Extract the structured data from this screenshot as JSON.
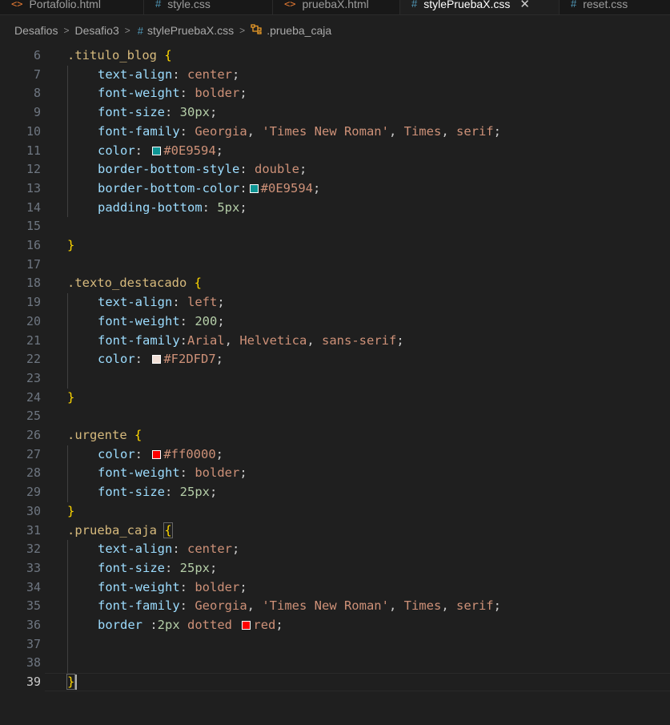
{
  "tabs": [
    {
      "label": "Portafolio.html",
      "icon": "html-icon",
      "active": false
    },
    {
      "label": "style.css",
      "icon": "css-icon",
      "active": false
    },
    {
      "label": "pruebaX.html",
      "icon": "html-icon",
      "active": false
    },
    {
      "label": "stylePruebaX.css",
      "icon": "css-icon",
      "active": true
    },
    {
      "label": "reset.css",
      "icon": "css-icon",
      "active": false
    }
  ],
  "breadcrumb": {
    "folder1": "Desafios",
    "folder2": "Desafio3",
    "file": "stylePruebaX.css",
    "symbol": ".prueba_caja"
  },
  "editor": {
    "current_line": "39",
    "lines": [
      {
        "n": "6",
        "tokens": [
          {
            "t": "sel",
            "v": ".titulo_blog"
          },
          {
            "t": "punct",
            "v": " "
          },
          {
            "t": "brace",
            "v": "{"
          }
        ]
      },
      {
        "n": "7",
        "indent": true,
        "tokens": [
          {
            "t": "prop",
            "v": "text-align"
          },
          {
            "t": "punct",
            "v": ": "
          },
          {
            "t": "val",
            "v": "center"
          },
          {
            "t": "punct",
            "v": ";"
          }
        ]
      },
      {
        "n": "8",
        "indent": true,
        "tokens": [
          {
            "t": "prop",
            "v": "font-weight"
          },
          {
            "t": "punct",
            "v": ": "
          },
          {
            "t": "val",
            "v": "bolder"
          },
          {
            "t": "punct",
            "v": ";"
          }
        ]
      },
      {
        "n": "9",
        "indent": true,
        "tokens": [
          {
            "t": "prop",
            "v": "font-size"
          },
          {
            "t": "punct",
            "v": ": "
          },
          {
            "t": "num",
            "v": "30px"
          },
          {
            "t": "punct",
            "v": ";"
          }
        ]
      },
      {
        "n": "10",
        "indent": true,
        "tokens": [
          {
            "t": "prop",
            "v": "font-family"
          },
          {
            "t": "punct",
            "v": ": "
          },
          {
            "t": "val",
            "v": "Georgia"
          },
          {
            "t": "punct",
            "v": ", "
          },
          {
            "t": "val",
            "v": "'Times New Roman'"
          },
          {
            "t": "punct",
            "v": ", "
          },
          {
            "t": "val",
            "v": "Times"
          },
          {
            "t": "punct",
            "v": ", "
          },
          {
            "t": "val",
            "v": "serif"
          },
          {
            "t": "punct",
            "v": ";"
          }
        ]
      },
      {
        "n": "11",
        "indent": true,
        "tokens": [
          {
            "t": "prop",
            "v": "color"
          },
          {
            "t": "punct",
            "v": ": "
          },
          {
            "t": "swatch",
            "c": "#0E9594"
          },
          {
            "t": "val",
            "v": "#0E9594"
          },
          {
            "t": "punct",
            "v": ";"
          }
        ]
      },
      {
        "n": "12",
        "indent": true,
        "tokens": [
          {
            "t": "prop",
            "v": "border-bottom-style"
          },
          {
            "t": "punct",
            "v": ": "
          },
          {
            "t": "val",
            "v": "double"
          },
          {
            "t": "punct",
            "v": ";"
          }
        ]
      },
      {
        "n": "13",
        "indent": true,
        "tokens": [
          {
            "t": "prop",
            "v": "border-bottom-color"
          },
          {
            "t": "punct",
            "v": ":"
          },
          {
            "t": "swatch",
            "c": "#0E9594"
          },
          {
            "t": "val",
            "v": "#0E9594"
          },
          {
            "t": "punct",
            "v": ";"
          }
        ]
      },
      {
        "n": "14",
        "indent": true,
        "tokens": [
          {
            "t": "prop",
            "v": "padding-bottom"
          },
          {
            "t": "punct",
            "v": ": "
          },
          {
            "t": "num",
            "v": "5px"
          },
          {
            "t": "punct",
            "v": ";"
          }
        ]
      },
      {
        "n": "15",
        "tokens": []
      },
      {
        "n": "16",
        "tokens": [
          {
            "t": "brace",
            "v": "}"
          }
        ]
      },
      {
        "n": "17",
        "tokens": []
      },
      {
        "n": "18",
        "tokens": [
          {
            "t": "sel",
            "v": ".texto_destacado"
          },
          {
            "t": "punct",
            "v": " "
          },
          {
            "t": "brace",
            "v": "{"
          }
        ]
      },
      {
        "n": "19",
        "indent": true,
        "tokens": [
          {
            "t": "prop",
            "v": "text-align"
          },
          {
            "t": "punct",
            "v": ": "
          },
          {
            "t": "val",
            "v": "left"
          },
          {
            "t": "punct",
            "v": ";"
          }
        ]
      },
      {
        "n": "20",
        "indent": true,
        "tokens": [
          {
            "t": "prop",
            "v": "font-weight"
          },
          {
            "t": "punct",
            "v": ": "
          },
          {
            "t": "num",
            "v": "200"
          },
          {
            "t": "punct",
            "v": ";"
          }
        ]
      },
      {
        "n": "21",
        "indent": true,
        "tokens": [
          {
            "t": "prop",
            "v": "font-family"
          },
          {
            "t": "punct",
            "v": ":"
          },
          {
            "t": "val",
            "v": "Arial"
          },
          {
            "t": "punct",
            "v": ", "
          },
          {
            "t": "val",
            "v": "Helvetica"
          },
          {
            "t": "punct",
            "v": ", "
          },
          {
            "t": "val",
            "v": "sans-serif"
          },
          {
            "t": "punct",
            "v": ";"
          }
        ]
      },
      {
        "n": "22",
        "indent": true,
        "tokens": [
          {
            "t": "prop",
            "v": "color"
          },
          {
            "t": "punct",
            "v": ": "
          },
          {
            "t": "swatch",
            "c": "#F2DFD7"
          },
          {
            "t": "val",
            "v": "#F2DFD7"
          },
          {
            "t": "punct",
            "v": ";"
          }
        ]
      },
      {
        "n": "23",
        "tokens": []
      },
      {
        "n": "24",
        "tokens": [
          {
            "t": "brace",
            "v": "}"
          }
        ]
      },
      {
        "n": "25",
        "tokens": []
      },
      {
        "n": "26",
        "tokens": [
          {
            "t": "sel",
            "v": ".urgente"
          },
          {
            "t": "punct",
            "v": " "
          },
          {
            "t": "brace",
            "v": "{"
          }
        ]
      },
      {
        "n": "27",
        "indent": true,
        "tokens": [
          {
            "t": "prop",
            "v": "color"
          },
          {
            "t": "punct",
            "v": ": "
          },
          {
            "t": "swatch",
            "c": "#ff0000"
          },
          {
            "t": "val",
            "v": "#ff0000"
          },
          {
            "t": "punct",
            "v": ";"
          }
        ]
      },
      {
        "n": "28",
        "indent": true,
        "tokens": [
          {
            "t": "prop",
            "v": "font-weight"
          },
          {
            "t": "punct",
            "v": ": "
          },
          {
            "t": "val",
            "v": "bolder"
          },
          {
            "t": "punct",
            "v": ";"
          }
        ]
      },
      {
        "n": "29",
        "indent": true,
        "tokens": [
          {
            "t": "prop",
            "v": "font-size"
          },
          {
            "t": "punct",
            "v": ": "
          },
          {
            "t": "num",
            "v": "25px"
          },
          {
            "t": "punct",
            "v": ";"
          }
        ]
      },
      {
        "n": "30",
        "tokens": [
          {
            "t": "brace",
            "v": "}"
          }
        ]
      },
      {
        "n": "31",
        "tokens": [
          {
            "t": "sel",
            "v": ".prueba_caja"
          },
          {
            "t": "punct",
            "v": " "
          },
          {
            "t": "brace-match",
            "v": "{"
          }
        ]
      },
      {
        "n": "32",
        "indent": true,
        "tokens": [
          {
            "t": "prop",
            "v": "text-align"
          },
          {
            "t": "punct",
            "v": ": "
          },
          {
            "t": "val",
            "v": "center"
          },
          {
            "t": "punct",
            "v": ";"
          }
        ]
      },
      {
        "n": "33",
        "indent": true,
        "tokens": [
          {
            "t": "prop",
            "v": "font-size"
          },
          {
            "t": "punct",
            "v": ": "
          },
          {
            "t": "num",
            "v": "25px"
          },
          {
            "t": "punct",
            "v": ";"
          }
        ]
      },
      {
        "n": "34",
        "indent": true,
        "tokens": [
          {
            "t": "prop",
            "v": "font-weight"
          },
          {
            "t": "punct",
            "v": ": "
          },
          {
            "t": "val",
            "v": "bolder"
          },
          {
            "t": "punct",
            "v": ";"
          }
        ]
      },
      {
        "n": "35",
        "indent": true,
        "tokens": [
          {
            "t": "prop",
            "v": "font-family"
          },
          {
            "t": "punct",
            "v": ": "
          },
          {
            "t": "val",
            "v": "Georgia"
          },
          {
            "t": "punct",
            "v": ", "
          },
          {
            "t": "val",
            "v": "'Times New Roman'"
          },
          {
            "t": "punct",
            "v": ", "
          },
          {
            "t": "val",
            "v": "Times"
          },
          {
            "t": "punct",
            "v": ", "
          },
          {
            "t": "val",
            "v": "serif"
          },
          {
            "t": "punct",
            "v": ";"
          }
        ]
      },
      {
        "n": "36",
        "indent": true,
        "tokens": [
          {
            "t": "prop",
            "v": "border"
          },
          {
            "t": "punct",
            "v": " :"
          },
          {
            "t": "num",
            "v": "2px"
          },
          {
            "t": "punct",
            "v": " "
          },
          {
            "t": "val",
            "v": "dotted"
          },
          {
            "t": "punct",
            "v": " "
          },
          {
            "t": "swatch",
            "c": "#ff0000"
          },
          {
            "t": "val",
            "v": "red"
          },
          {
            "t": "punct",
            "v": ";"
          }
        ]
      },
      {
        "n": "37",
        "tokens": []
      },
      {
        "n": "38",
        "tokens": []
      },
      {
        "n": "39",
        "tokens": [
          {
            "t": "brace-match",
            "v": "}"
          }
        ]
      }
    ]
  }
}
